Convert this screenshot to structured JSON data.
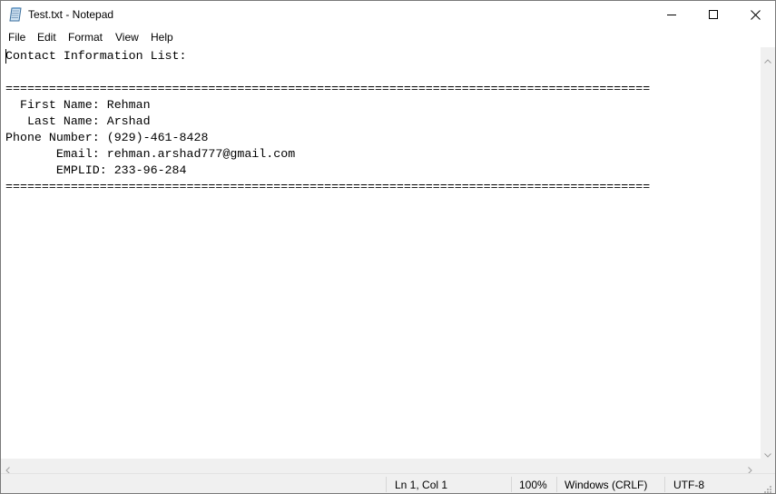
{
  "window": {
    "title": "Test.txt - Notepad"
  },
  "menu": {
    "items": [
      "File",
      "Edit",
      "Format",
      "View",
      "Help"
    ]
  },
  "editor": {
    "lines": [
      "Contact Information List:",
      "",
      "=========================================================================================",
      "  First Name: Rehman",
      "   Last Name: Arshad",
      "Phone Number: (929)-461-8428",
      "       Email: rehman.arshad777@gmail.com",
      "       EMPLID: 233-96-284",
      "========================================================================================="
    ]
  },
  "status": {
    "position": "Ln 1, Col 1",
    "zoom": "100%",
    "line_ending": "Windows (CRLF)",
    "encoding": "UTF-8"
  },
  "icons": {
    "app": "notepad-icon",
    "minimize": "minimize-icon",
    "maximize": "maximize-icon",
    "close": "close-icon"
  },
  "colors": {
    "chrome": "#f0f0f0",
    "text": "#000000",
    "background": "#ffffff"
  }
}
